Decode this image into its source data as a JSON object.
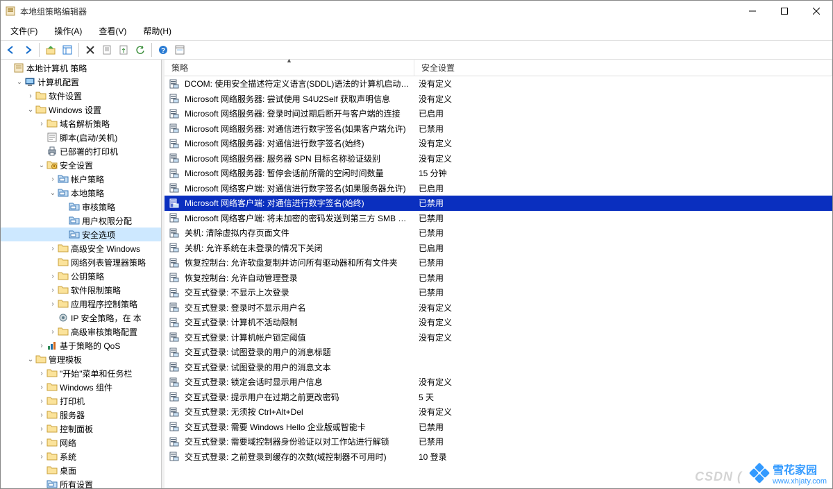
{
  "window": {
    "title": "本地组策略编辑器"
  },
  "menu": {
    "file": "文件(F)",
    "operation": "操作(A)",
    "view": "查看(V)",
    "help": "帮助(H)"
  },
  "columns": {
    "policy": "策略",
    "setting": "安全设置"
  },
  "tree": {
    "root": "本地计算机 策略",
    "computer_config": "计算机配置",
    "software_settings": "软件设置",
    "windows_settings": "Windows 设置",
    "name_resolution": "域名解析策略",
    "scripts": "脚本(启动/关机)",
    "deployed_printers": "已部署的打印机",
    "security_settings": "安全设置",
    "account_policies": "帐户策略",
    "local_policies": "本地策略",
    "audit_policy": "审核策略",
    "user_rights": "用户权限分配",
    "security_options": "安全选项",
    "adv_windows_fw": "高级安全 Windows",
    "nl_manager": "网络列表管理器策略",
    "public_key": "公钥策略",
    "software_restrict": "软件限制策略",
    "app_control": "应用程序控制策略",
    "ip_security": "IP 安全策略，在 本",
    "adv_audit": "高级审核策略配置",
    "policy_based_qos": "基于策略的 QoS",
    "admin_templates": "管理模板",
    "start_taskbar": "\"开始\"菜单和任务栏",
    "windows_components": "Windows 组件",
    "printers": "打印机",
    "server": "服务器",
    "control_panel": "控制面板",
    "network": "网络",
    "system": "系统",
    "desktop": "桌面",
    "all_settings": "所有设置"
  },
  "policies": [
    {
      "name": "DCOM: 使用安全描述符定义语言(SDDL)语法的计算机启动…",
      "setting": "没有定义"
    },
    {
      "name": "Microsoft 网络服务器: 尝试使用 S4U2Self 获取声明信息",
      "setting": "没有定义"
    },
    {
      "name": "Microsoft 网络服务器: 登录时间过期后断开与客户端的连接",
      "setting": "已启用"
    },
    {
      "name": "Microsoft 网络服务器: 对通信进行数字签名(如果客户端允许)",
      "setting": "已禁用"
    },
    {
      "name": "Microsoft 网络服务器: 对通信进行数字签名(始终)",
      "setting": "没有定义"
    },
    {
      "name": "Microsoft 网络服务器: 服务器 SPN 目标名称验证级别",
      "setting": "没有定义"
    },
    {
      "name": "Microsoft 网络服务器: 暂停会话前所需的空闲时间数量",
      "setting": "15 分钟"
    },
    {
      "name": "Microsoft 网络客户端: 对通信进行数字签名(如果服务器允许)",
      "setting": "已启用"
    },
    {
      "name": "Microsoft 网络客户端: 对通信进行数字签名(始终)",
      "setting": "已禁用",
      "selected": true
    },
    {
      "name": "Microsoft 网络客户端: 将未加密的密码发送到第三方 SMB …",
      "setting": "已禁用"
    },
    {
      "name": "关机: 清除虚拟内存页面文件",
      "setting": "已禁用"
    },
    {
      "name": "关机: 允许系统在未登录的情况下关闭",
      "setting": "已启用"
    },
    {
      "name": "恢复控制台: 允许软盘复制并访问所有驱动器和所有文件夹",
      "setting": "已禁用"
    },
    {
      "name": "恢复控制台: 允许自动管理登录",
      "setting": "已禁用"
    },
    {
      "name": "交互式登录: 不显示上次登录",
      "setting": "已禁用"
    },
    {
      "name": "交互式登录: 登录时不显示用户名",
      "setting": "没有定义"
    },
    {
      "name": "交互式登录: 计算机不活动限制",
      "setting": "没有定义"
    },
    {
      "name": "交互式登录: 计算机帐户锁定阈值",
      "setting": "没有定义"
    },
    {
      "name": "交互式登录: 试图登录的用户的消息标题",
      "setting": ""
    },
    {
      "name": "交互式登录: 试图登录的用户的消息文本",
      "setting": ""
    },
    {
      "name": "交互式登录: 锁定会话时显示用户信息",
      "setting": "没有定义"
    },
    {
      "name": "交互式登录: 提示用户在过期之前更改密码",
      "setting": "5 天"
    },
    {
      "name": "交互式登录: 无须按 Ctrl+Alt+Del",
      "setting": "没有定义"
    },
    {
      "name": "交互式登录: 需要 Windows Hello 企业版或智能卡",
      "setting": "已禁用"
    },
    {
      "name": "交互式登录: 需要域控制器身份验证以对工作站进行解锁",
      "setting": "已禁用"
    },
    {
      "name": "交互式登录: 之前登录到缓存的次数(域控制器不可用时)",
      "setting": "10 登录"
    }
  ],
  "watermark": {
    "brand": "雪花家园",
    "url": "www.xhjaty.com",
    "faded": "CSDN ("
  }
}
